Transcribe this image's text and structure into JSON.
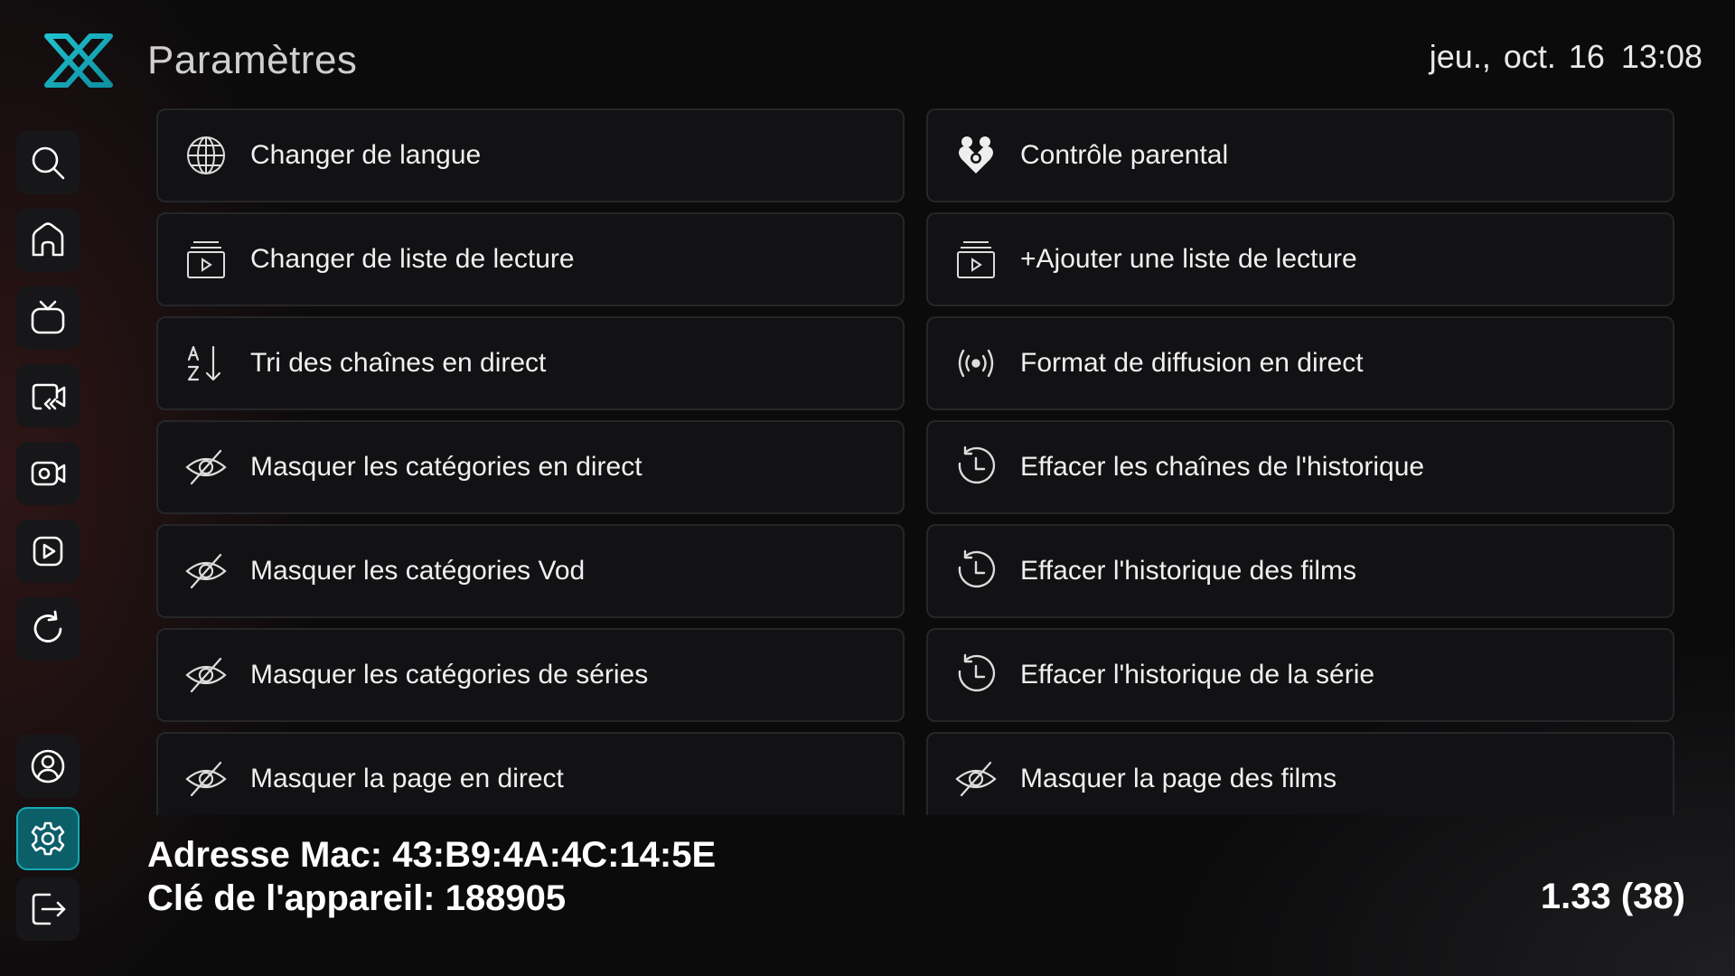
{
  "header": {
    "title": "Paramètres",
    "date": "jeu., oct. 16",
    "time": "13:08",
    "accent_color": "#17b3c0"
  },
  "sidebar": {
    "items": [
      {
        "icon": "search-icon",
        "active": false
      },
      {
        "icon": "home-icon",
        "active": false
      },
      {
        "icon": "tv-icon",
        "active": false
      },
      {
        "icon": "catchup-icon",
        "active": false
      },
      {
        "icon": "movies-icon",
        "active": false
      },
      {
        "icon": "series-play-icon",
        "active": false
      },
      {
        "icon": "refresh-icon",
        "active": false
      },
      {
        "icon": "account-icon",
        "active": false
      },
      {
        "icon": "settings-icon",
        "active": true
      },
      {
        "icon": "logout-icon",
        "active": false
      }
    ]
  },
  "settings": {
    "left": [
      {
        "label": "Changer de langue",
        "icon": "globe-icon"
      },
      {
        "label": "Changer de liste de lecture",
        "icon": "playlist-icon"
      },
      {
        "label": "Tri des chaînes en direct",
        "icon": "sort-az-icon"
      },
      {
        "label": "Masquer les catégories en direct",
        "icon": "eye-off-icon"
      },
      {
        "label": "Masquer les catégories Vod",
        "icon": "eye-off-icon"
      },
      {
        "label": "Masquer les catégories de séries",
        "icon": "eye-off-icon"
      },
      {
        "label": "Masquer la page en direct",
        "icon": "eye-off-icon"
      }
    ],
    "right": [
      {
        "label": "Contrôle parental",
        "icon": "parental-icon"
      },
      {
        "label": "+Ajouter une liste de lecture",
        "icon": "playlist-icon"
      },
      {
        "label": "Format de diffusion en direct",
        "icon": "broadcast-icon"
      },
      {
        "label": "Effacer les chaînes de l'historique",
        "icon": "history-icon"
      },
      {
        "label": "Effacer l'historique des films",
        "icon": "history-icon"
      },
      {
        "label": "Effacer l'historique de la série",
        "icon": "history-icon"
      },
      {
        "label": "Masquer la page des films",
        "icon": "eye-off-icon"
      }
    ]
  },
  "footer": {
    "mac_line": "Adresse Mac: 43:B9:4A:4C:14:5E",
    "device_key_line": "Clé de l'appareil: 188905",
    "version": "1.33 (38)"
  }
}
